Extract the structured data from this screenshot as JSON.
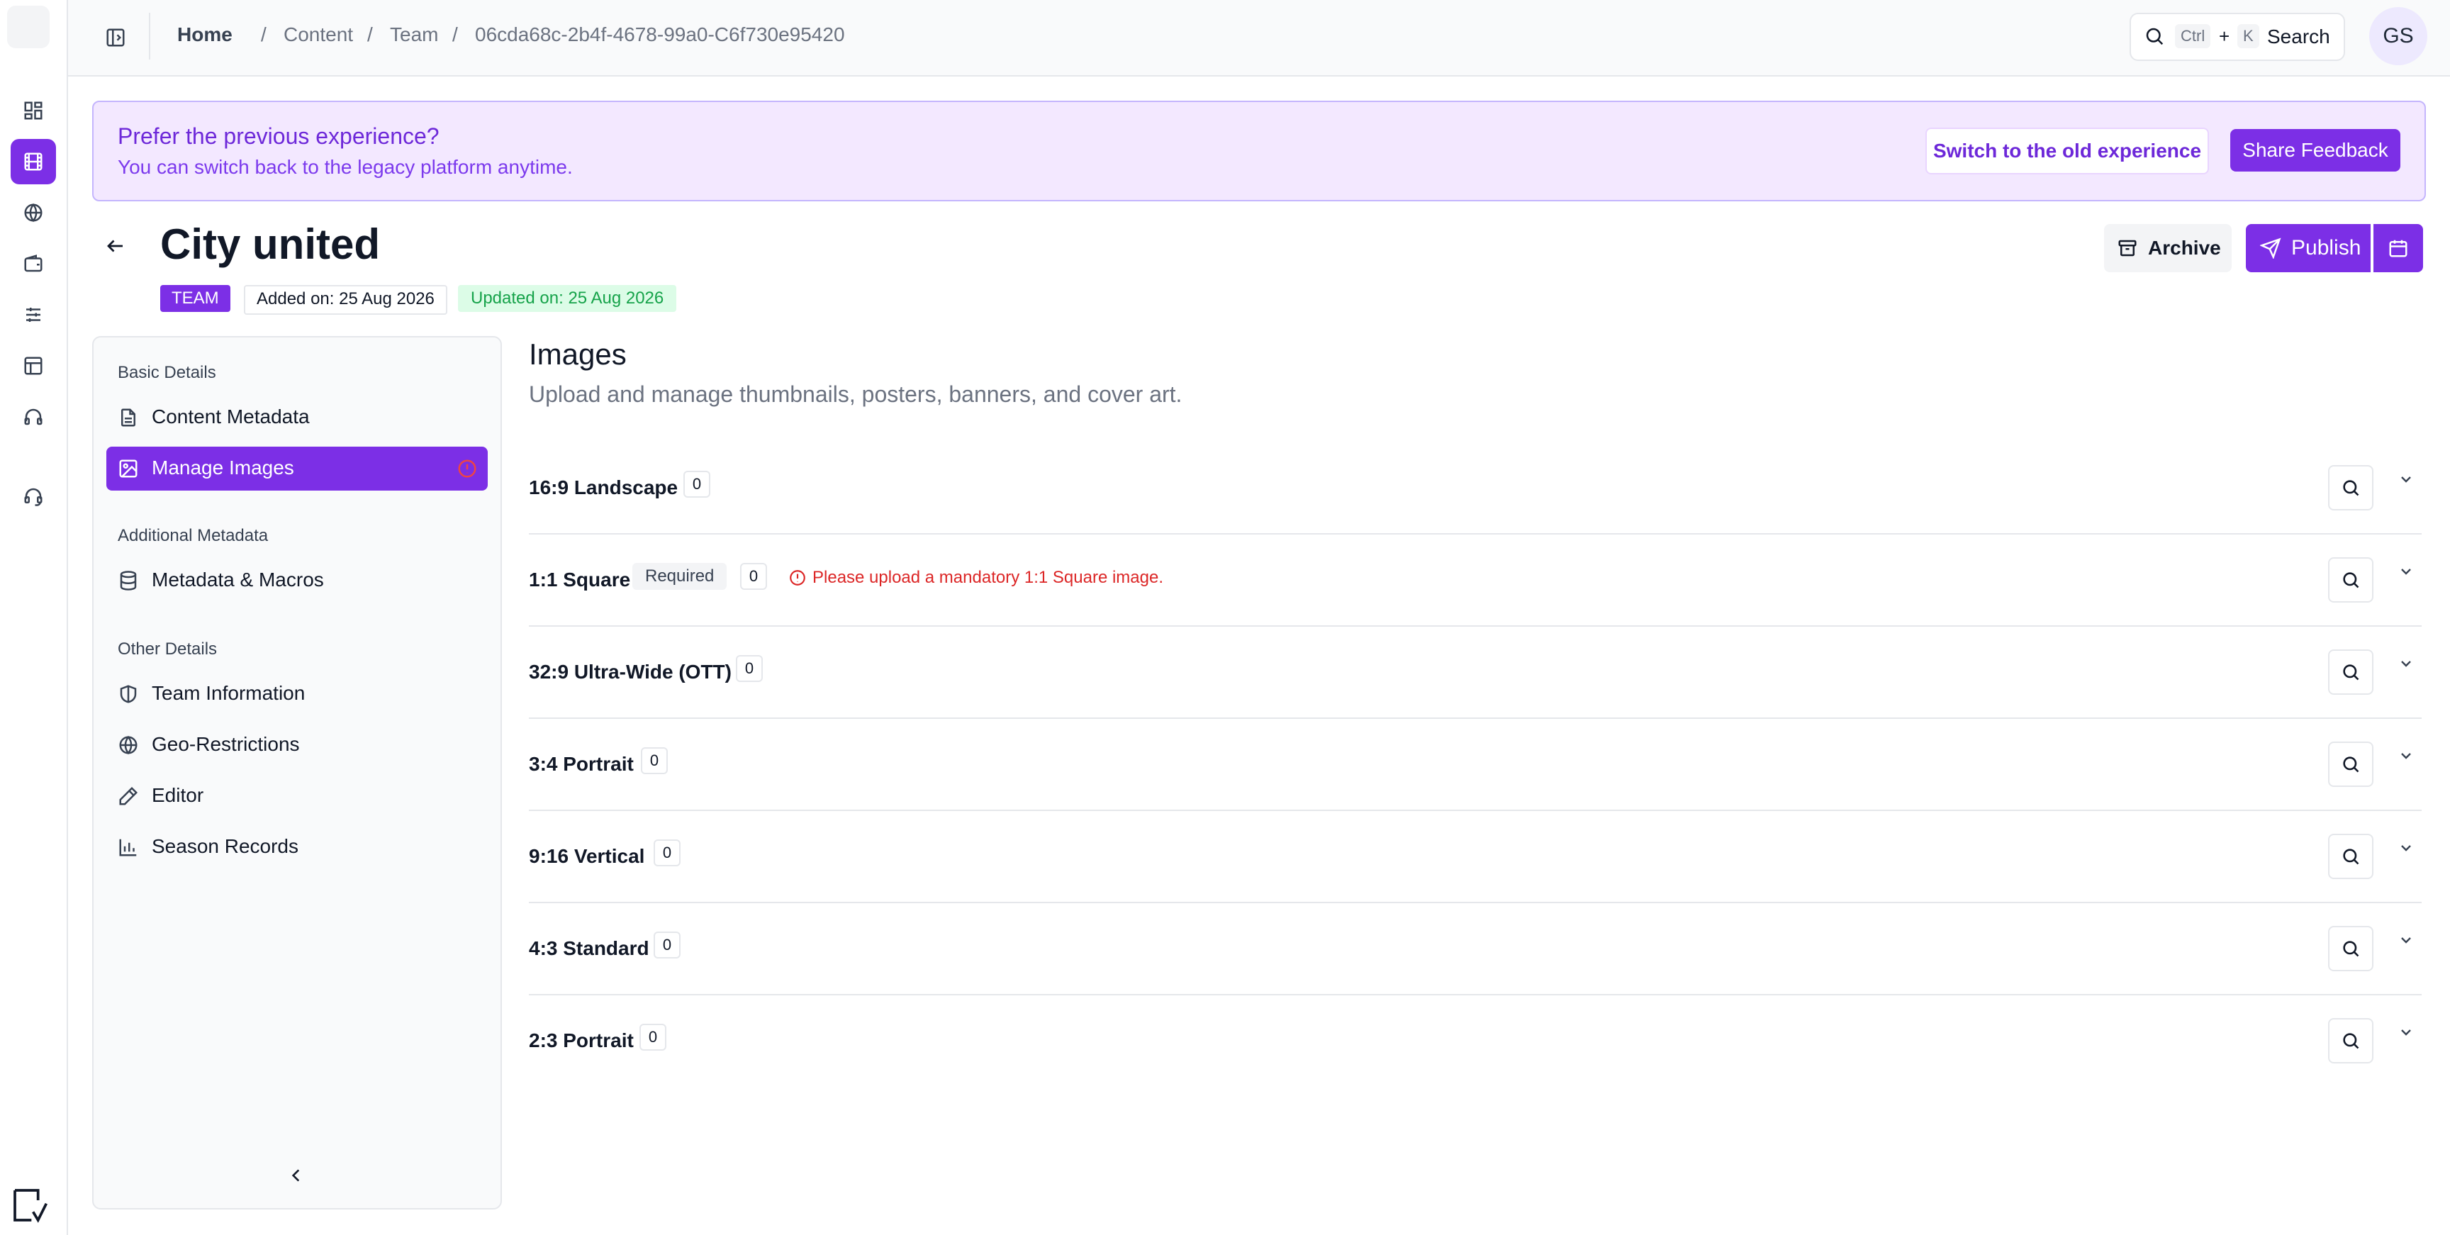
{
  "breadcrumb": {
    "home": "Home",
    "items": [
      "Content",
      "Team",
      "06cda68c-2b4f-4678-99a0-C6f730e95420"
    ],
    "separator": "/"
  },
  "search": {
    "kbd_ctrl": "Ctrl",
    "plus": "+",
    "kbd_key": "K",
    "label": "Search"
  },
  "user": {
    "initials": "GS"
  },
  "banner": {
    "title": "Prefer the previous experience?",
    "subtitle": "You can switch back to the legacy platform anytime.",
    "switch_label": "Switch to the old experience",
    "feedback_label": "Share Feedback"
  },
  "header": {
    "title": "City united",
    "type_badge": "TEAM",
    "added": "Added on: 25 Aug 2026",
    "updated": "Updated on: 25 Aug 2026",
    "archive_label": "Archive",
    "publish_label": "Publish"
  },
  "sidebar": {
    "sections": [
      {
        "label": "Basic Details",
        "items": [
          {
            "label": "Content Metadata",
            "icon": "file-text-icon",
            "active": false
          },
          {
            "label": "Manage Images",
            "icon": "image-icon",
            "active": true,
            "alert": true
          }
        ]
      },
      {
        "label": "Additional Metadata",
        "items": [
          {
            "label": "Metadata & Macros",
            "icon": "database-icon",
            "active": false
          }
        ]
      },
      {
        "label": "Other Details",
        "items": [
          {
            "label": "Team Information",
            "icon": "shield-icon",
            "active": false
          },
          {
            "label": "Geo-Restrictions",
            "icon": "globe-icon",
            "active": false
          },
          {
            "label": "Editor",
            "icon": "pencil-icon",
            "active": false
          },
          {
            "label": "Season Records",
            "icon": "bar-chart-icon",
            "active": false
          }
        ]
      }
    ]
  },
  "main": {
    "title": "Images",
    "subtitle": "Upload and manage thumbnails, posters, banners, and cover art.",
    "rows": [
      {
        "name": "16:9 Landscape",
        "count": "0",
        "required": false
      },
      {
        "name": "1:1 Square",
        "count": "0",
        "required": true,
        "required_label": "Required",
        "error": "Please upload a mandatory 1:1 Square image."
      },
      {
        "name": "32:9 Ultra-Wide (OTT)",
        "count": "0",
        "required": false
      },
      {
        "name": "3:4 Portrait",
        "count": "0",
        "required": false
      },
      {
        "name": "9:16 Vertical",
        "count": "0",
        "required": false
      },
      {
        "name": "4:3 Standard",
        "count": "0",
        "required": false
      },
      {
        "name": "2:3 Portrait",
        "count": "0",
        "required": false
      }
    ]
  },
  "rail": {
    "items": [
      "dashboard-icon",
      "film-icon",
      "globe-icon",
      "wallet-icon",
      "sliders-icon",
      "layout-icon",
      "headphones-icon",
      "headset-icon"
    ],
    "active_index": 1
  },
  "colors": {
    "accent": "#7c2fe6",
    "error": "#dc2626",
    "success": "#16a34a"
  }
}
